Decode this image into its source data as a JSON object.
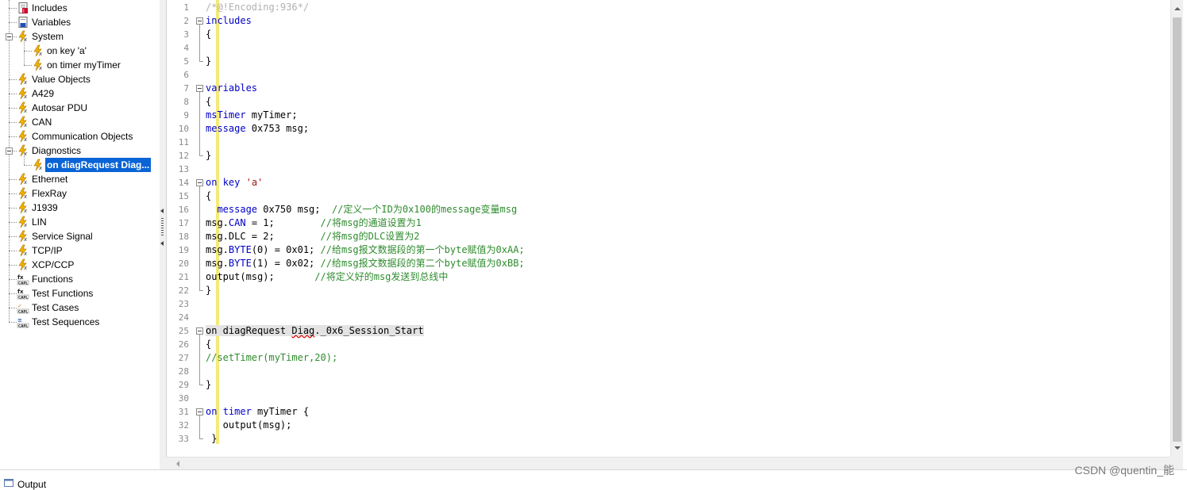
{
  "tree": {
    "items": [
      {
        "label": "Includes",
        "icon": "includes-icon",
        "level": 0
      },
      {
        "label": "Variables",
        "icon": "variables-icon",
        "level": 0
      },
      {
        "label": "System",
        "icon": "event-handler-icon",
        "level": 0,
        "expanded": true
      },
      {
        "label": "on key 'a'",
        "icon": "event-handler-icon",
        "level": 1
      },
      {
        "label": "on timer myTimer",
        "icon": "event-handler-icon",
        "level": 1
      },
      {
        "label": "Value Objects",
        "icon": "event-handler-icon",
        "level": 0
      },
      {
        "label": "A429",
        "icon": "event-handler-icon",
        "level": 0
      },
      {
        "label": "Autosar PDU",
        "icon": "event-handler-icon",
        "level": 0
      },
      {
        "label": "CAN",
        "icon": "event-handler-icon",
        "level": 0
      },
      {
        "label": "Communication Objects",
        "icon": "event-handler-icon",
        "level": 0
      },
      {
        "label": "Diagnostics",
        "icon": "event-handler-icon",
        "level": 0,
        "expanded": true
      },
      {
        "label": "on diagRequest Diag...",
        "icon": "event-handler-icon",
        "level": 1,
        "selected": true
      },
      {
        "label": "Ethernet",
        "icon": "event-handler-icon",
        "level": 0
      },
      {
        "label": "FlexRay",
        "icon": "event-handler-icon",
        "level": 0
      },
      {
        "label": "J1939",
        "icon": "event-handler-icon",
        "level": 0
      },
      {
        "label": "LIN",
        "icon": "event-handler-icon",
        "level": 0
      },
      {
        "label": "Service Signal",
        "icon": "event-handler-icon",
        "level": 0
      },
      {
        "label": "TCP/IP",
        "icon": "event-handler-icon",
        "level": 0
      },
      {
        "label": "XCP/CCP",
        "icon": "event-handler-icon",
        "level": 0
      },
      {
        "label": "Functions",
        "icon": "capl-functions-icon",
        "level": 0
      },
      {
        "label": "Test Functions",
        "icon": "capl-test-functions-icon",
        "level": 0
      },
      {
        "label": "Test Cases",
        "icon": "capl-test-cases-icon",
        "level": 0
      },
      {
        "label": "Test Sequences",
        "icon": "capl-test-sequences-icon",
        "level": 0
      }
    ]
  },
  "editor": {
    "lines": [
      {
        "n": "1",
        "tokens": [
          {
            "t": "/*@!Encoding:936*/",
            "c": "cm-faint"
          }
        ]
      },
      {
        "n": "2",
        "tokens": [
          {
            "t": "includes",
            "c": "kw"
          }
        ]
      },
      {
        "n": "3",
        "tokens": [
          {
            "t": "{"
          }
        ]
      },
      {
        "n": "4",
        "tokens": []
      },
      {
        "n": "5",
        "tokens": [
          {
            "t": "}"
          }
        ]
      },
      {
        "n": "6",
        "tokens": []
      },
      {
        "n": "7",
        "tokens": [
          {
            "t": "variables",
            "c": "kw"
          }
        ]
      },
      {
        "n": "8",
        "tokens": [
          {
            "t": "{"
          }
        ]
      },
      {
        "n": "9",
        "tokens": [
          {
            "t": "msTimer",
            "c": "kw"
          },
          {
            "t": " myTimer;"
          }
        ]
      },
      {
        "n": "10",
        "tokens": [
          {
            "t": "message",
            "c": "kw"
          },
          {
            "t": " 0x753 msg;"
          }
        ]
      },
      {
        "n": "11",
        "tokens": []
      },
      {
        "n": "12",
        "tokens": [
          {
            "t": "}"
          }
        ]
      },
      {
        "n": "13",
        "tokens": []
      },
      {
        "n": "14",
        "tokens": [
          {
            "t": "on",
            "c": "kw"
          },
          {
            "t": " "
          },
          {
            "t": "key",
            "c": "kw"
          },
          {
            "t": " "
          },
          {
            "t": "'a'",
            "c": "str"
          }
        ]
      },
      {
        "n": "15",
        "tokens": [
          {
            "t": "{"
          }
        ]
      },
      {
        "n": "16",
        "tokens": [
          {
            "t": "  "
          },
          {
            "t": "message",
            "c": "kw"
          },
          {
            "t": " 0x750 msg;  "
          },
          {
            "t": "//定义一个ID为0x100的message变量msg",
            "c": "cm"
          }
        ]
      },
      {
        "n": "17",
        "tokens": [
          {
            "t": "msg."
          },
          {
            "t": "CAN",
            "c": "kw"
          },
          {
            "t": " = 1;        "
          },
          {
            "t": "//将msg的通道设置为1",
            "c": "cm"
          }
        ]
      },
      {
        "n": "18",
        "tokens": [
          {
            "t": "msg.DLC = 2;        "
          },
          {
            "t": "//将msg的DLC设置为2",
            "c": "cm"
          }
        ]
      },
      {
        "n": "19",
        "tokens": [
          {
            "t": "msg."
          },
          {
            "t": "BYTE",
            "c": "kw"
          },
          {
            "t": "(0) = 0x01; "
          },
          {
            "t": "//给msg报文数据段的第一个byte赋值为0xAA;",
            "c": "cm"
          }
        ]
      },
      {
        "n": "20",
        "tokens": [
          {
            "t": "msg."
          },
          {
            "t": "BYTE",
            "c": "kw"
          },
          {
            "t": "(1) = 0x02; "
          },
          {
            "t": "//给msg报文数据段的第二个byte赋值为0xBB;",
            "c": "cm"
          }
        ]
      },
      {
        "n": "21",
        "tokens": [
          {
            "t": "output(msg);       "
          },
          {
            "t": "//将定义好的msg发送到总线中",
            "c": "cm"
          }
        ]
      },
      {
        "n": "22",
        "tokens": [
          {
            "t": "}"
          }
        ]
      },
      {
        "n": "23",
        "tokens": []
      },
      {
        "n": "24",
        "tokens": []
      },
      {
        "n": "25",
        "tokens": [
          {
            "t": "on diagRequest ",
            "c": "hl"
          },
          {
            "t": "Diag",
            "c": "hl squig"
          },
          {
            "t": "._0x6_Session_Start",
            "c": "hl"
          }
        ]
      },
      {
        "n": "26",
        "tokens": [
          {
            "t": "{"
          }
        ]
      },
      {
        "n": "27",
        "tokens": [
          {
            "t": "//setTimer(myTimer,20);",
            "c": "cm"
          }
        ]
      },
      {
        "n": "28",
        "tokens": []
      },
      {
        "n": "29",
        "tokens": [
          {
            "t": "}"
          }
        ]
      },
      {
        "n": "30",
        "tokens": []
      },
      {
        "n": "31",
        "tokens": [
          {
            "t": "on",
            "c": "kw"
          },
          {
            "t": " "
          },
          {
            "t": "timer",
            "c": "kw"
          },
          {
            "t": " myTimer {"
          }
        ]
      },
      {
        "n": "32",
        "tokens": [
          {
            "t": "   output(msg);"
          }
        ]
      },
      {
        "n": "33",
        "tokens": [
          {
            "t": " }"
          }
        ]
      }
    ]
  },
  "output_panel": {
    "label": "Output"
  },
  "watermark": "CSDN @quentin_能",
  "colors": {
    "keyword": "#0000c8",
    "comment": "#2e8b2e",
    "string": "#a31515",
    "selection": "#0a64d6",
    "change_bar": "#f4ea7a"
  }
}
